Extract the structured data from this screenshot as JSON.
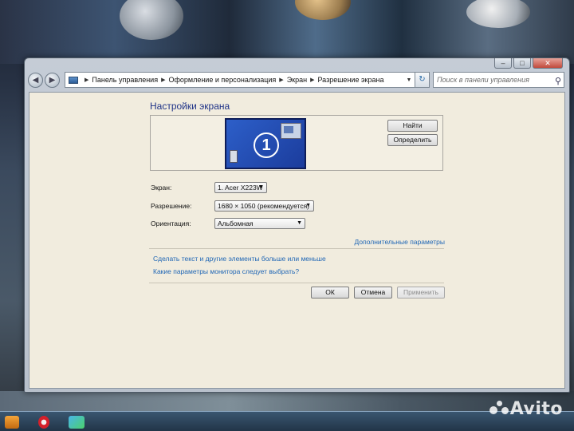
{
  "window": {
    "breadcrumbs": [
      "Панель управления",
      "Оформление и персонализация",
      "Экран",
      "Разрешение экрана"
    ],
    "search_placeholder": "Поиск в панели управления"
  },
  "page": {
    "title": "Настройки экрана",
    "monitor_number": "1",
    "find_button": "Найти",
    "detect_button": "Определить",
    "screen_label": "Экран:",
    "screen_value": "1. Acer X223W",
    "resolution_label": "Разрешение:",
    "resolution_value": "1680 × 1050 (рекомендуется)",
    "orientation_label": "Ориентация:",
    "orientation_value": "Альбомная",
    "advanced_link": "Дополнительные параметры",
    "text_size_link": "Сделать текст и другие элементы больше или меньше",
    "monitor_help_link": "Какие параметры монитора следует выбрать?",
    "ok_button": "ОК",
    "cancel_button": "Отмена",
    "apply_button": "Применить"
  },
  "watermark": {
    "text": "Avito"
  }
}
